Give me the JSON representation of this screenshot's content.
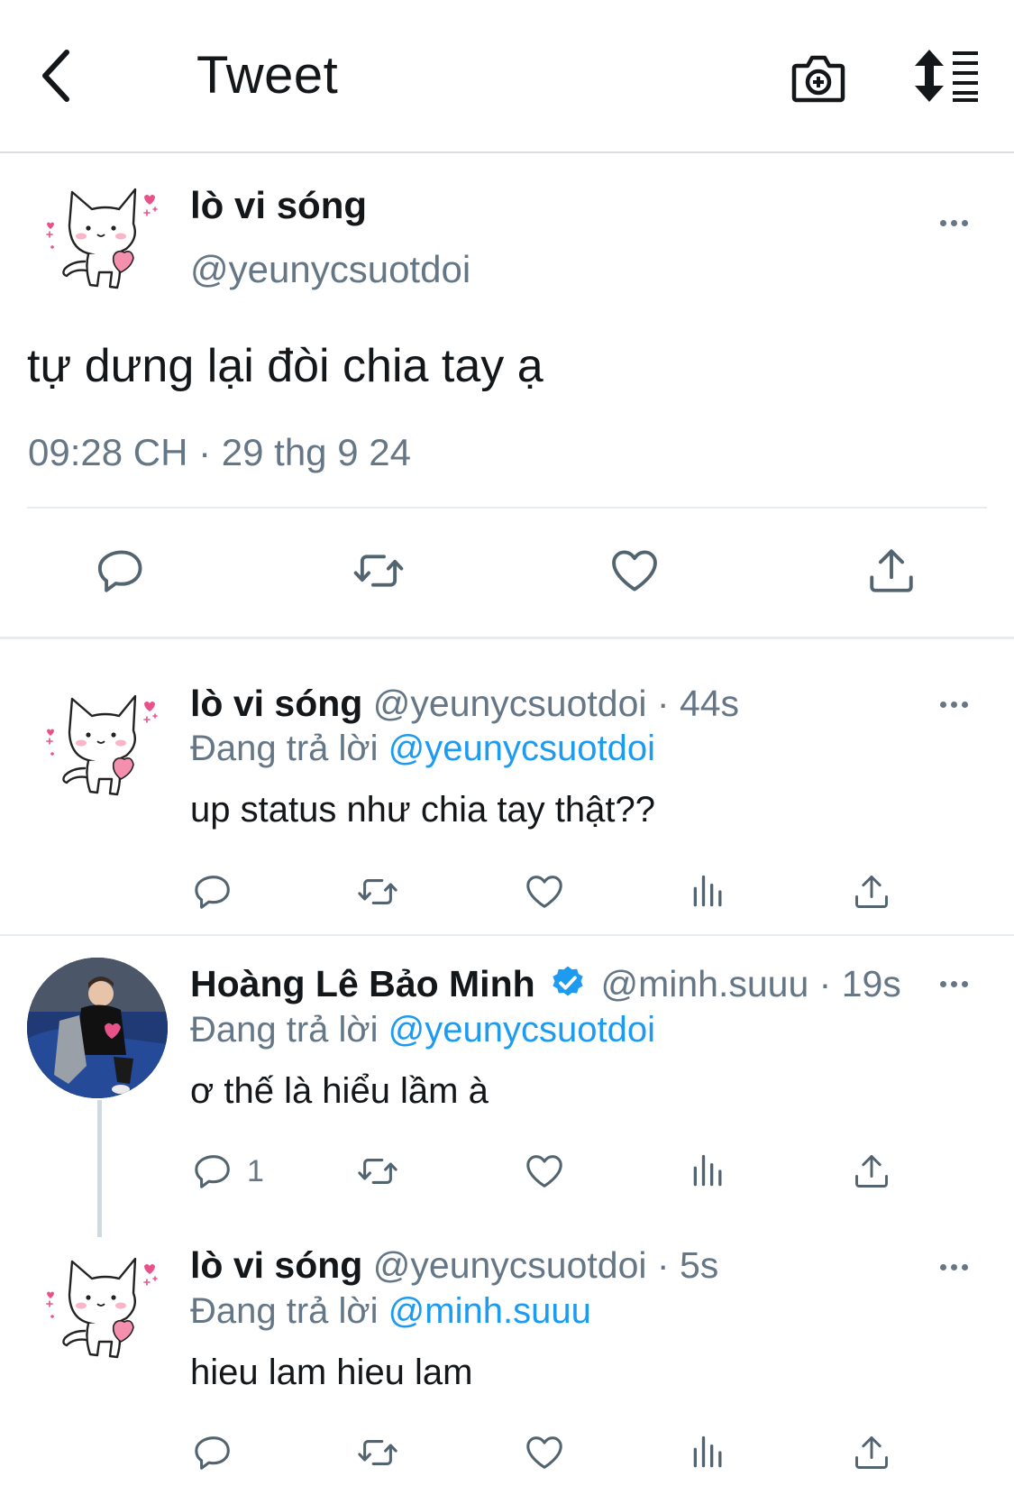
{
  "header": {
    "title": "Tweet"
  },
  "main_tweet": {
    "name": "lò vi sóng",
    "handle": "@yeunycsuotdoi",
    "text": "tự dưng lại đòi chia tay ạ",
    "timestamp": "09:28 CH · 29 thg 9 24"
  },
  "replies": [
    {
      "name": "lò vi sóng",
      "handle_time": "@yeunycsuotdoi · 44s",
      "replying_label": "Đang trả lời",
      "replying_to": "@yeunycsuotdoi",
      "text": "up status như chia tay thật??"
    },
    {
      "name": "Hoàng Lê Bảo Minh",
      "verified": true,
      "handle_time": "@minh.suuu · 19s",
      "replying_label": "Đang trả lời",
      "replying_to": "@yeunycsuotdoi",
      "text": "ơ thế là hiểu lầm à",
      "reply_count": "1"
    },
    {
      "name": "lò vi sóng",
      "handle_time": "@yeunycsuotdoi · 5s",
      "replying_label": "Đang trả lời",
      "replying_to": "@minh.suuu",
      "text": "hieu lam hieu lam"
    }
  ],
  "colors": {
    "accent": "#1d9bf0",
    "secondary_text": "#657786",
    "icon": "#536471",
    "verified": "#1d9bf0"
  },
  "icons": [
    "back-icon",
    "camera-plus-icon",
    "sort-icon",
    "reply-icon",
    "retweet-icon",
    "like-icon",
    "views-icon",
    "share-icon",
    "more-icon",
    "verified-icon"
  ]
}
